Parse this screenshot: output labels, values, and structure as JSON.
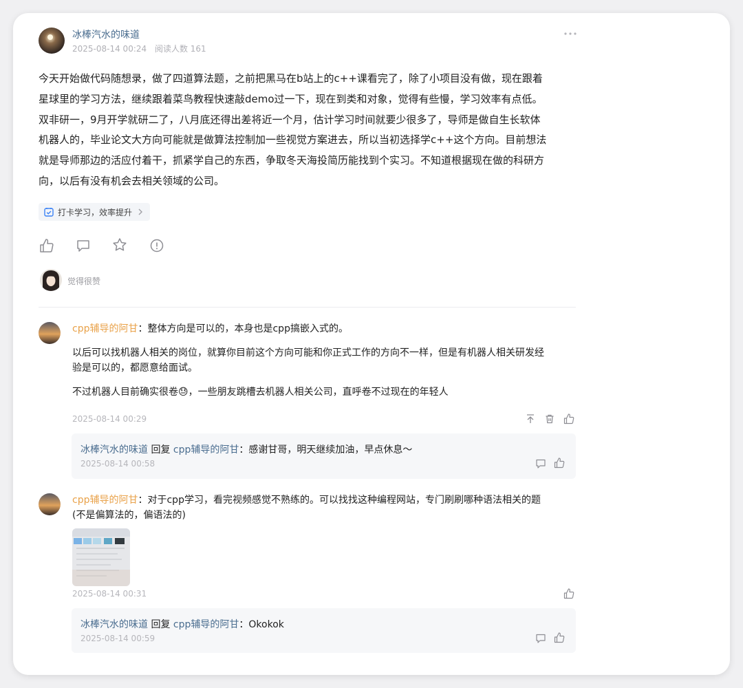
{
  "post": {
    "author": "冰棒汽水的味道",
    "time": "2025-08-14 00:24",
    "reads": "阅读人数 161",
    "more_icon": "more-dots-icon",
    "body_lines": [
      "今天开始做代码随想录，做了四道算法题，之前把黑马在b站上的c++课看完了，除了小项目没有做，现在跟着",
      "星球里的学习方法，继续跟着菜鸟教程快速敲demo过一下，现在到类和对象，觉得有些慢，学习效率有点低。",
      "双非研一，9月开学就研二了，八月底还得出差将近一个月，估计学习时间就要少很多了，导师是做自生长软体",
      "机器人的，毕业论文大方向可能就是做算法控制加一些视觉方案进去，所以当初选择学c++这个方向。目前想法",
      "就是导师那边的活应付着干，抓紧学自己的东西，争取冬天海投简历能找到个实习。不知道根据现在做的科研方",
      "向，以后有没有机会去相关领域的公司。"
    ],
    "tag": "打卡学习，效率提升",
    "actions": [
      "like-icon",
      "comment-icon",
      "star-icon",
      "report-icon"
    ],
    "liked_by": "觉得很赞"
  },
  "comments": [
    {
      "author": "cpp辅导的阿甘",
      "paragraphs": [
        "：整体方向是可以的，本身也是cpp搞嵌入式的。",
        "以后可以找机器人相关的岗位，就算你目前这个方向可能和你正式工作的方向不一样，但是有机器人相关研发经",
        "验是可以的，都愿意给面试。",
        "不过机器人目前确实很卷",
        "，一些朋友跳槽去机器人相关公司，直呼卷不过现在的年轻人"
      ],
      "emoji": "😓",
      "time": "2025-08-14 00:29",
      "reply": {
        "from": "冰棒汽水的味道",
        "verb": " 回复 ",
        "to": "cpp辅导的阿甘",
        "text": "：感谢甘哥，明天继续加油，早点休息～",
        "time": "2025-08-14 00:58"
      }
    },
    {
      "author": "cpp辅导的阿甘",
      "lines": [
        "：对于cpp学习，看完视频感觉不熟练的。可以找找这种编程网站，专门刷刷哪种语法相关的题",
        "(不是偏算法的，偏语法的)"
      ],
      "time": "2025-08-14 00:31",
      "reply": {
        "from": "冰棒汽水的味道",
        "verb": " 回复 ",
        "to": "cpp辅导的阿甘",
        "text": "：Okokok",
        "time": "2025-08-14 00:59"
      }
    }
  ],
  "colors": {
    "accent_name": "#4a6d8f",
    "commenter": "#e9a24a",
    "muted": "#b0b0b6"
  }
}
